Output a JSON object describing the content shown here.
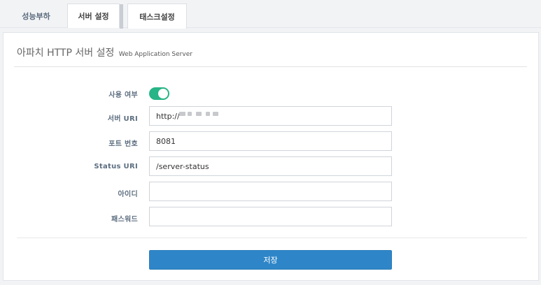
{
  "tabs": [
    {
      "label": "성능부하"
    },
    {
      "label": "서버 설정"
    },
    {
      "label": "태스크설정"
    }
  ],
  "panel": {
    "title": "아파치 HTTP 서버 설정",
    "subtitle": "Web Application Server"
  },
  "form": {
    "enabled": {
      "label": "사용 여부",
      "value": true
    },
    "server_uri": {
      "label": "서버 URI",
      "value": "http://"
    },
    "port": {
      "label": "포트 번호",
      "value": "8081"
    },
    "status_uri": {
      "label": "Status URI",
      "value": "/server-status"
    },
    "user_id": {
      "label": "아이디",
      "value": ""
    },
    "password": {
      "label": "패스워드",
      "value": ""
    }
  },
  "actions": {
    "save_label": "저장"
  },
  "colors": {
    "accent": "#2e86c8",
    "toggle_on": "#27b486"
  }
}
